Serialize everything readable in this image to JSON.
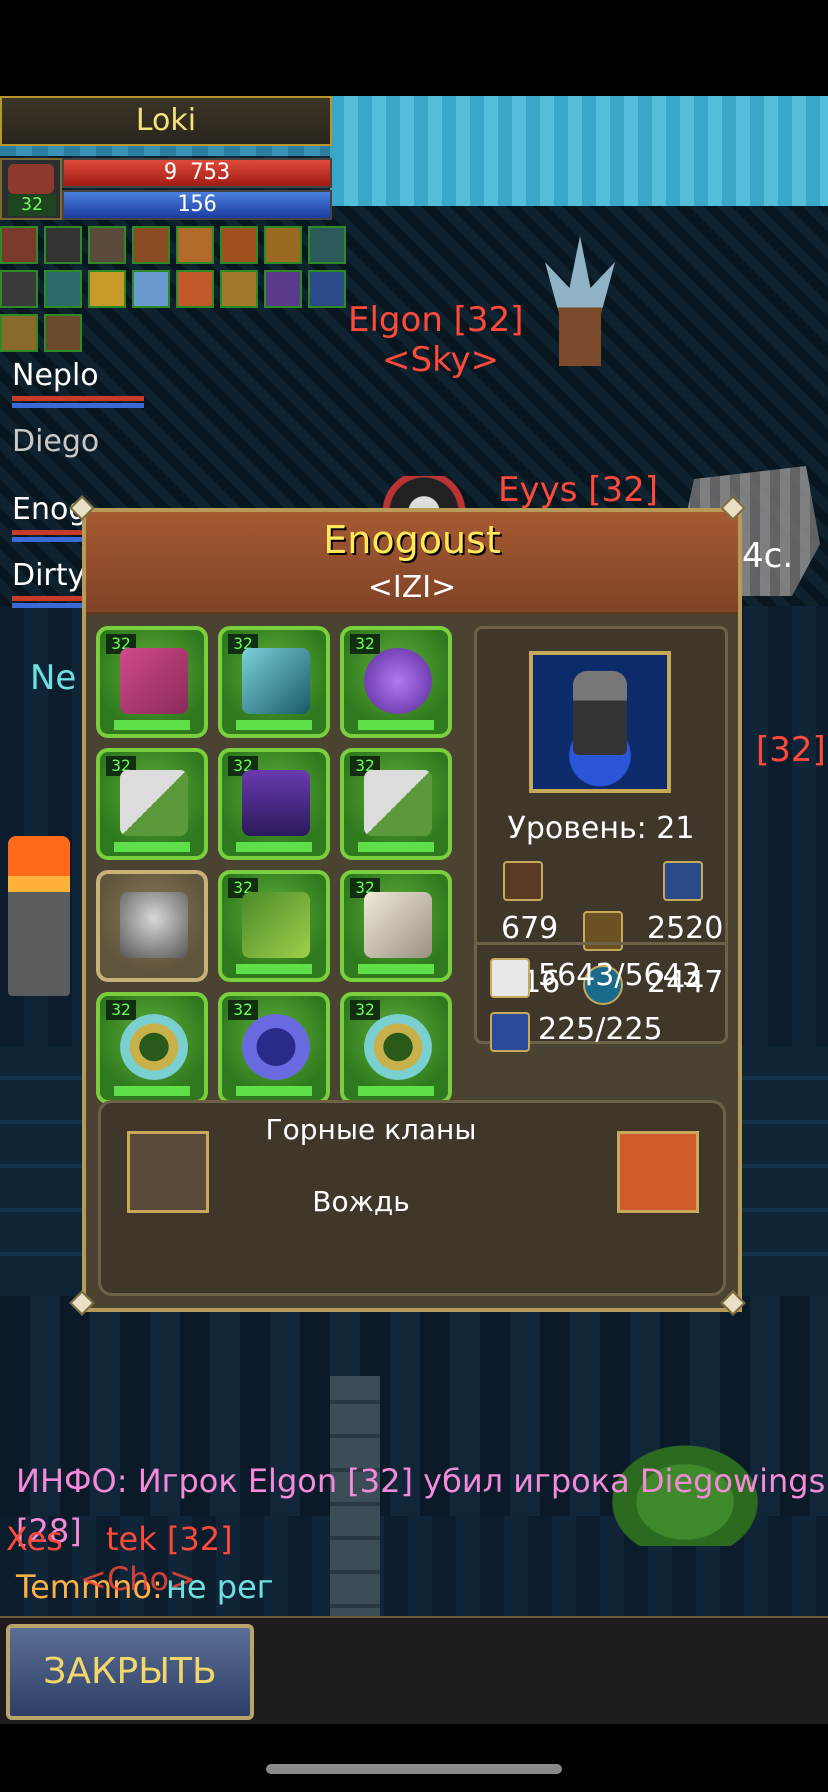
{
  "player": {
    "name": "Loki",
    "hp": "9 753",
    "mp": "156",
    "level": "32"
  },
  "party": [
    "Neplo",
    "Diego",
    "Enog",
    "Dirty"
  ],
  "party_partial": "Ne",
  "world": {
    "elgon_name": "Elgon [32]",
    "elgon_clan": "<Sky>",
    "eyys": "Eyys [32]",
    "timer": "4c.",
    "lvl_right": "[32]"
  },
  "panel": {
    "name": "Enogoust",
    "clan_tag": "<IZI>",
    "level_label": "Уровень: 21",
    "slot_levels": [
      "32",
      "32",
      "32",
      "32",
      "32",
      "32",
      "",
      "32",
      "32",
      "32",
      "32",
      "32"
    ],
    "attack": "679",
    "defense": "2520",
    "stat3": "516",
    "stat4": "2447",
    "hp": "5643/5643",
    "mp": "225/225",
    "clan_name": "Горные кланы",
    "clan_rank": "Вождь"
  },
  "chat": {
    "info": "ИНФО: Игрок Elgon [32] убил игрока Diegowings",
    "info_level": "[28]",
    "line2_name": "Xes",
    "line2_rest": "tek [32]",
    "line3_name": "Temmno:",
    "line3_rest": "не рег",
    "line3_overlap": "<Cho>"
  },
  "buttons": {
    "close": "ЗАКРЫТЬ"
  }
}
